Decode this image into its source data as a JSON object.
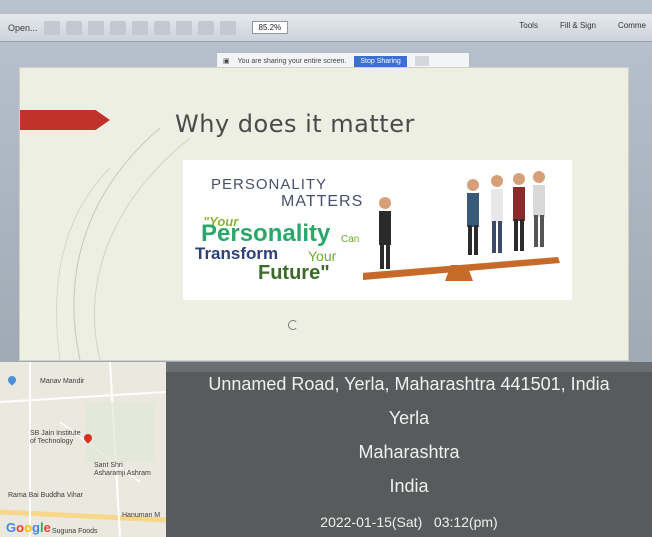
{
  "toolbar": {
    "open_label": "Open...",
    "zoom": "85.2%",
    "tools_label": "Tools",
    "fill_sign_label": "Fill & Sign",
    "comment_label": "Comme"
  },
  "share_bar": {
    "message": "You are sharing your entire screen.",
    "stop_label": "Stop Sharing"
  },
  "slide": {
    "title": "Why does it matter",
    "image": {
      "line1": "PERSONALITY",
      "line2": "MATTERS",
      "quote_open": "\"Your",
      "big_word": "Personality",
      "can": "Can",
      "transform": "Transform",
      "your": "Your",
      "future": "Future\""
    }
  },
  "map": {
    "labels": {
      "manav_mandir": "Manav Mandir",
      "sb_jain": "SB Jain Institute of Technology",
      "sant_shri": "Sant Shri Asharamji Ashram",
      "ramabai": "Rama Bai Buddha Vihar",
      "hanuman": "Hanuman M",
      "suguna": "Suguna Foods"
    },
    "google": "Google",
    "google_colors": [
      "#4285F4",
      "#EA4335",
      "#FBBC05",
      "#4285F4",
      "#34A853",
      "#EA4335"
    ]
  },
  "location": {
    "address": "Unnamed Road, Yerla, Maharashtra 441501, India",
    "city": "Yerla",
    "state": "Maharashtra",
    "country": "India",
    "timestamp": "2022-01-15(Sat)   03:12(pm)"
  }
}
